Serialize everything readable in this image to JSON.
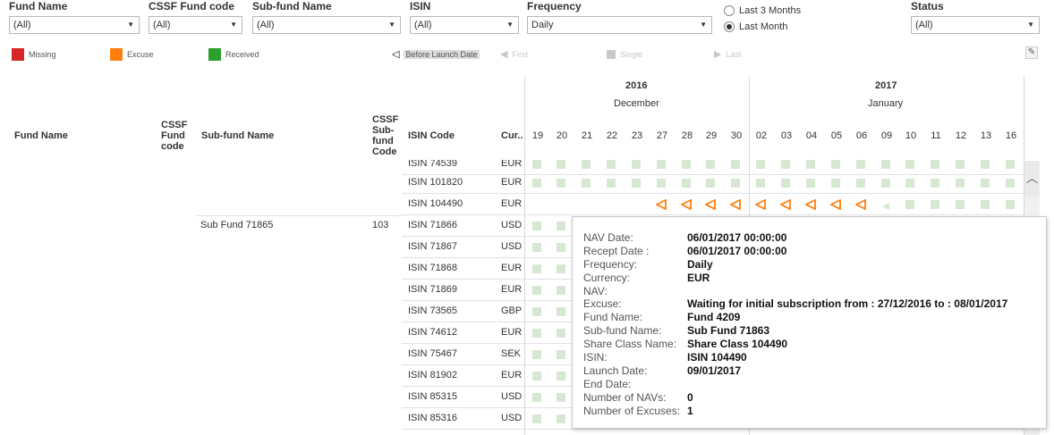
{
  "filters": [
    {
      "label": "Fund Name",
      "value": "(All)"
    },
    {
      "label": "CSSF Fund code",
      "value": "(All)"
    },
    {
      "label": "Sub-fund Name",
      "value": "(All)"
    },
    {
      "label": "ISIN",
      "value": "(All)"
    },
    {
      "label": "Frequency",
      "value": "Daily"
    },
    {
      "label": "Status",
      "value": "(All)"
    }
  ],
  "period": {
    "options": [
      {
        "label": "Last 3 Months",
        "selected": false
      },
      {
        "label": "Last Month",
        "selected": true
      }
    ]
  },
  "legend": [
    {
      "label": "Missing",
      "color": "#d62728"
    },
    {
      "label": "Excuse",
      "color": "#ff7f0e"
    },
    {
      "label": "Received",
      "color": "#2ca02c"
    },
    {
      "label": "Before Launch Date",
      "icon": "triangle-left-outline-icon"
    },
    {
      "label": "First",
      "icon": "triangle-left-icon"
    },
    {
      "label": "Single",
      "icon": "square-icon"
    },
    {
      "label": "Last",
      "icon": "triangle-right-icon"
    }
  ],
  "columns": {
    "fund_name": "Fund Name",
    "cssf_fund_code": [
      "CSSF",
      "Fund",
      "code"
    ],
    "sub_fund_name": "Sub-fund Name",
    "cssf_sub_fund_code": [
      "CSSF",
      "Sub-",
      "fund",
      "Code"
    ],
    "isin_code": "ISIN Code",
    "currency": "Cur.."
  },
  "calendar": {
    "years": [
      "2016",
      "2017"
    ],
    "months": [
      "December",
      "January"
    ],
    "days_2016": [
      "19",
      "20",
      "21",
      "22",
      "23",
      "27",
      "28",
      "29",
      "30"
    ],
    "days_2017": [
      "02",
      "03",
      "04",
      "05",
      "06",
      "09",
      "10",
      "11",
      "12",
      "13",
      "16"
    ]
  },
  "rows_top": [
    {
      "isin": "ISIN 74539",
      "currency": "EUR"
    },
    {
      "isin": "ISIN 101820",
      "currency": "EUR"
    },
    {
      "isin": "ISIN 104490",
      "currency": "EUR"
    }
  ],
  "sub_fund": {
    "name": "Sub Fund 71865",
    "code": "103"
  },
  "rows_sub": [
    {
      "isin": "ISIN 71866",
      "currency": "USD"
    },
    {
      "isin": "ISIN 71867",
      "currency": "USD"
    },
    {
      "isin": "ISIN 71868",
      "currency": "EUR"
    },
    {
      "isin": "ISIN 71869",
      "currency": "EUR"
    },
    {
      "isin": "ISIN 73565",
      "currency": "GBP"
    },
    {
      "isin": "ISIN 74612",
      "currency": "EUR"
    },
    {
      "isin": "ISIN 75467",
      "currency": "SEK"
    },
    {
      "isin": "ISIN 81902",
      "currency": "EUR"
    },
    {
      "isin": "ISIN 85315",
      "currency": "USD"
    },
    {
      "isin": "ISIN 85316",
      "currency": "USD"
    }
  ],
  "tooltip": [
    {
      "key": "NAV Date:",
      "value": "06/01/2017 00:00:00"
    },
    {
      "key": "Recept Date :",
      "value": "06/01/2017 00:00:00"
    },
    {
      "key": "Frequency:",
      "value": "Daily"
    },
    {
      "key": "Currency:",
      "value": "EUR"
    },
    {
      "key": "NAV:",
      "value": ""
    },
    {
      "key": "Excuse:",
      "value": "Waiting for initial subscription from : 27/12/2016 to : 08/01/2017"
    },
    {
      "key": "Fund Name:",
      "value": "Fund 4209"
    },
    {
      "key": "Sub-fund Name:",
      "value": "Sub Fund 71863"
    },
    {
      "key": "Share Class Name:",
      "value": "Share Class 104490"
    },
    {
      "key": "ISIN:",
      "value": "ISIN 104490"
    },
    {
      "key": "Launch Date:",
      "value": "09/01/2017"
    },
    {
      "key": "End Date:",
      "value": ""
    },
    {
      "key": "Number of NAVs:",
      "value": "0"
    },
    {
      "key": "Number of Excuses:",
      "value": "1"
    }
  ],
  "colors": {
    "received_light": "#d6e8d1",
    "excuse": "#ff7f0e",
    "before_launch": "#000000"
  }
}
